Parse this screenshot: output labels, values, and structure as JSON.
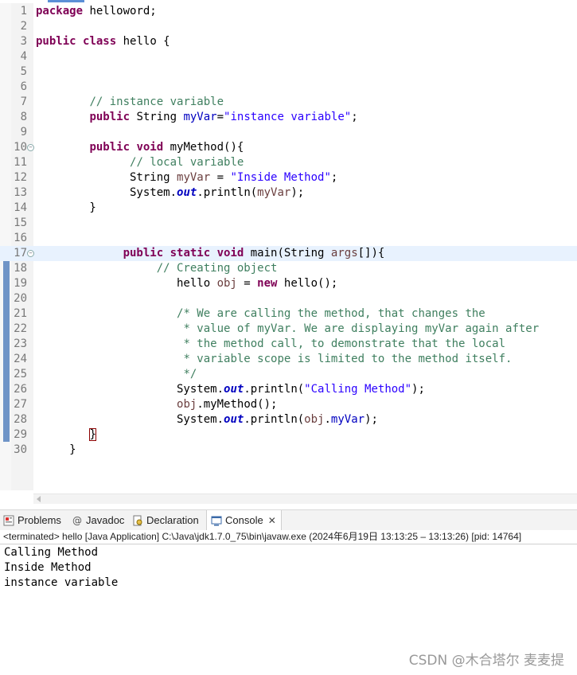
{
  "editor": {
    "current_line": 17,
    "folds": [
      10,
      17
    ],
    "lines": [
      {
        "n": "1",
        "tokens": [
          {
            "t": "package",
            "c": "kw"
          },
          {
            "t": " helloword;",
            "c": "pln"
          }
        ]
      },
      {
        "n": "2",
        "tokens": []
      },
      {
        "n": "3",
        "tokens": [
          {
            "t": "public",
            "c": "kw"
          },
          {
            "t": " ",
            "c": "pln"
          },
          {
            "t": "class",
            "c": "kw"
          },
          {
            "t": " hello {",
            "c": "pln"
          }
        ]
      },
      {
        "n": "4",
        "tokens": []
      },
      {
        "n": "5",
        "tokens": []
      },
      {
        "n": "6",
        "tokens": []
      },
      {
        "n": "7",
        "tokens": [
          {
            "t": "        ",
            "c": "pln"
          },
          {
            "t": "// instance variable",
            "c": "cm"
          }
        ]
      },
      {
        "n": "8",
        "tokens": [
          {
            "t": "        ",
            "c": "pln"
          },
          {
            "t": "public",
            "c": "kw"
          },
          {
            "t": " String ",
            "c": "pln"
          },
          {
            "t": "myVar",
            "c": "fld"
          },
          {
            "t": "=",
            "c": "pln"
          },
          {
            "t": "\"instance variable\"",
            "c": "str"
          },
          {
            "t": ";",
            "c": "pln"
          }
        ]
      },
      {
        "n": "9",
        "tokens": []
      },
      {
        "n": "10",
        "tokens": [
          {
            "t": "        ",
            "c": "pln"
          },
          {
            "t": "public",
            "c": "kw"
          },
          {
            "t": " ",
            "c": "pln"
          },
          {
            "t": "void",
            "c": "kw"
          },
          {
            "t": " myMethod(){",
            "c": "pln"
          }
        ]
      },
      {
        "n": "11",
        "tokens": [
          {
            "t": "              ",
            "c": "pln"
          },
          {
            "t": "// local variable",
            "c": "cm"
          }
        ]
      },
      {
        "n": "12",
        "tokens": [
          {
            "t": "              String ",
            "c": "pln"
          },
          {
            "t": "myVar",
            "c": "lvar"
          },
          {
            "t": " = ",
            "c": "pln"
          },
          {
            "t": "\"Inside Method\"",
            "c": "str"
          },
          {
            "t": ";",
            "c": "pln"
          }
        ]
      },
      {
        "n": "13",
        "tokens": [
          {
            "t": "              System.",
            "c": "pln"
          },
          {
            "t": "out",
            "c": "sfld"
          },
          {
            "t": ".println(",
            "c": "pln"
          },
          {
            "t": "myVar",
            "c": "lvar"
          },
          {
            "t": ");",
            "c": "pln"
          }
        ]
      },
      {
        "n": "14",
        "tokens": [
          {
            "t": "        }",
            "c": "pln"
          }
        ]
      },
      {
        "n": "15",
        "tokens": []
      },
      {
        "n": "16",
        "tokens": []
      },
      {
        "n": "17",
        "tokens": [
          {
            "t": "             ",
            "c": "pln"
          },
          {
            "t": "public",
            "c": "kw"
          },
          {
            "t": " ",
            "c": "pln"
          },
          {
            "t": "static",
            "c": "kw"
          },
          {
            "t": " ",
            "c": "pln"
          },
          {
            "t": "void",
            "c": "kw"
          },
          {
            "t": " main(String ",
            "c": "pln"
          },
          {
            "t": "args",
            "c": "lvar"
          },
          {
            "t": "[]){",
            "c": "pln"
          }
        ]
      },
      {
        "n": "18",
        "tokens": [
          {
            "t": "                  ",
            "c": "pln"
          },
          {
            "t": "// Creating object",
            "c": "cm"
          }
        ]
      },
      {
        "n": "19",
        "tokens": [
          {
            "t": "                     hello ",
            "c": "pln"
          },
          {
            "t": "obj",
            "c": "lvar"
          },
          {
            "t": " = ",
            "c": "pln"
          },
          {
            "t": "new",
            "c": "kw"
          },
          {
            "t": " hello();",
            "c": "pln"
          }
        ]
      },
      {
        "n": "20",
        "tokens": []
      },
      {
        "n": "21",
        "tokens": [
          {
            "t": "                     ",
            "c": "pln"
          },
          {
            "t": "/* We are calling the method, that changes the",
            "c": "cm"
          }
        ]
      },
      {
        "n": "22",
        "tokens": [
          {
            "t": "                      ",
            "c": "pln"
          },
          {
            "t": "* value of myVar. We are displaying myVar again after",
            "c": "cm"
          }
        ]
      },
      {
        "n": "23",
        "tokens": [
          {
            "t": "                      ",
            "c": "pln"
          },
          {
            "t": "* the method call, to demonstrate that the local",
            "c": "cm"
          }
        ]
      },
      {
        "n": "24",
        "tokens": [
          {
            "t": "                      ",
            "c": "pln"
          },
          {
            "t": "* variable scope is limited to the method itself.",
            "c": "cm"
          }
        ]
      },
      {
        "n": "25",
        "tokens": [
          {
            "t": "                      ",
            "c": "pln"
          },
          {
            "t": "*/",
            "c": "cm"
          }
        ]
      },
      {
        "n": "26",
        "tokens": [
          {
            "t": "                     System.",
            "c": "pln"
          },
          {
            "t": "out",
            "c": "sfld"
          },
          {
            "t": ".println(",
            "c": "pln"
          },
          {
            "t": "\"Calling Method\"",
            "c": "str"
          },
          {
            "t": ");",
            "c": "pln"
          }
        ]
      },
      {
        "n": "27",
        "tokens": [
          {
            "t": "                     ",
            "c": "pln"
          },
          {
            "t": "obj",
            "c": "lvar"
          },
          {
            "t": ".myMethod();",
            "c": "pln"
          }
        ]
      },
      {
        "n": "28",
        "tokens": [
          {
            "t": "                     System.",
            "c": "pln"
          },
          {
            "t": "out",
            "c": "sfld"
          },
          {
            "t": ".println(",
            "c": "pln"
          },
          {
            "t": "obj",
            "c": "lvar"
          },
          {
            "t": ".",
            "c": "pln"
          },
          {
            "t": "myVar",
            "c": "fld"
          },
          {
            "t": ");",
            "c": "pln"
          }
        ]
      },
      {
        "n": "29",
        "tokens": [
          {
            "t": "        ",
            "c": "pln"
          },
          {
            "t": "}",
            "c": "pln",
            "box": true
          }
        ]
      },
      {
        "n": "30",
        "tokens": [
          {
            "t": "     }",
            "c": "pln"
          }
        ]
      }
    ]
  },
  "views": {
    "tabs": [
      {
        "name": "problems",
        "label": "Problems",
        "icon": "problems-icon",
        "active": false
      },
      {
        "name": "javadoc",
        "label": "Javadoc",
        "icon": "javadoc-icon",
        "active": false
      },
      {
        "name": "declaration",
        "label": "Declaration",
        "icon": "declaration-icon",
        "active": false
      },
      {
        "name": "console",
        "label": "Console",
        "icon": "console-icon",
        "active": true
      }
    ],
    "close_glyph": "✕"
  },
  "console": {
    "header": "<terminated> hello [Java Application] C:\\Java\\jdk1.7.0_75\\bin\\javaw.exe  (2024年6月19日 13:13:25 – 13:13:26) [pid: 14764]",
    "output": [
      "Calling Method",
      "Inside Method",
      "instance variable"
    ]
  },
  "watermark": "CSDN @木合塔尔 麦麦提",
  "colors": {
    "keyword": "#7f0055",
    "string": "#2a00ff",
    "comment": "#3f7f5f",
    "field": "#0000c0",
    "current_line": "#e8f2fe"
  }
}
